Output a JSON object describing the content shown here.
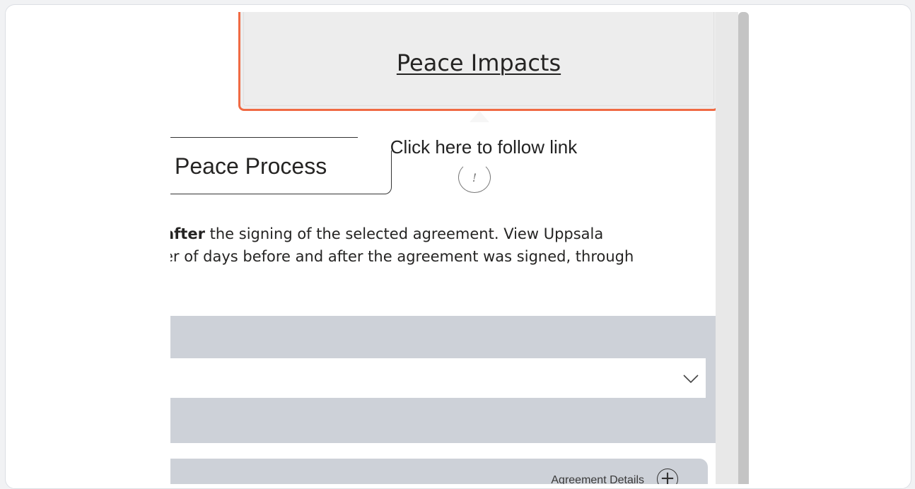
{
  "link": {
    "label": "Peace Impacts"
  },
  "tooltip": {
    "text": "Click here to follow link"
  },
  "tab": {
    "label": "Peace Process"
  },
  "description": {
    "line1_bold": "after",
    "line1_rest": " the signing of the selected agreement. View Uppsala",
    "line2": "er of days before and after the agreement was signed, through"
  },
  "details": {
    "label": "Agreement Details",
    "plus": "+"
  },
  "colors": {
    "highlight": "#f06a43",
    "card": "#cdd1d8"
  },
  "icons": {
    "dropdown": "chevron-down-icon",
    "info": "info-icon",
    "expand": "plus-circle-icon"
  }
}
